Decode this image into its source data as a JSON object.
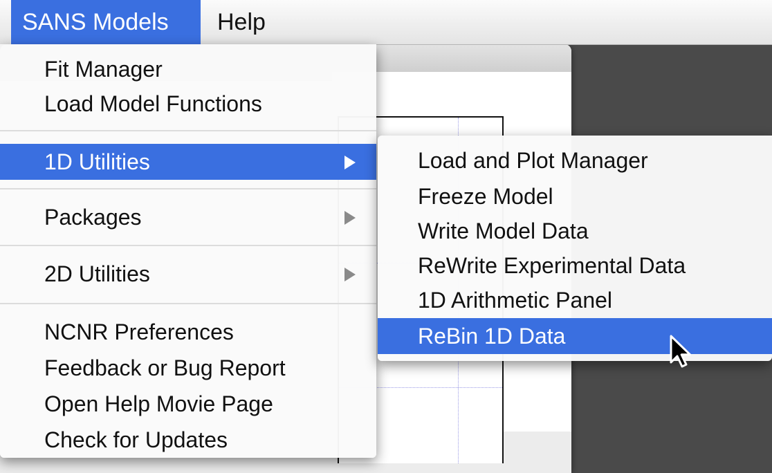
{
  "menubar": {
    "items": [
      {
        "label": "SANS Models",
        "active": true
      },
      {
        "label": "Help",
        "active": false
      }
    ]
  },
  "main_menu": {
    "items": [
      {
        "label": "Fit Manager"
      },
      {
        "label": "Load Model Functions"
      },
      {
        "label": "1D Utilities",
        "submenu": true,
        "highlighted": true
      },
      {
        "label": "Packages",
        "submenu": true
      },
      {
        "label": "2D Utilities",
        "submenu": true
      },
      {
        "label": "NCNR Preferences"
      },
      {
        "label": "Feedback or Bug Report"
      },
      {
        "label": "Open Help Movie Page"
      },
      {
        "label": "Check for Updates"
      }
    ]
  },
  "submenu_1d_utilities": {
    "items": [
      {
        "label": "Load and Plot Manager"
      },
      {
        "label": "Freeze Model"
      },
      {
        "label": "Write Model Data"
      },
      {
        "label": "ReWrite Experimental Data"
      },
      {
        "label": "1D Arithmetic Panel"
      },
      {
        "label": "ReBin 1D Data",
        "highlighted": true
      }
    ]
  },
  "colors": {
    "highlight": "#3a6fe0",
    "desktop": "#4a4a4a"
  },
  "icons": {
    "submenu_arrow": "triangle-right-icon",
    "cursor": "arrow-cursor-icon"
  }
}
